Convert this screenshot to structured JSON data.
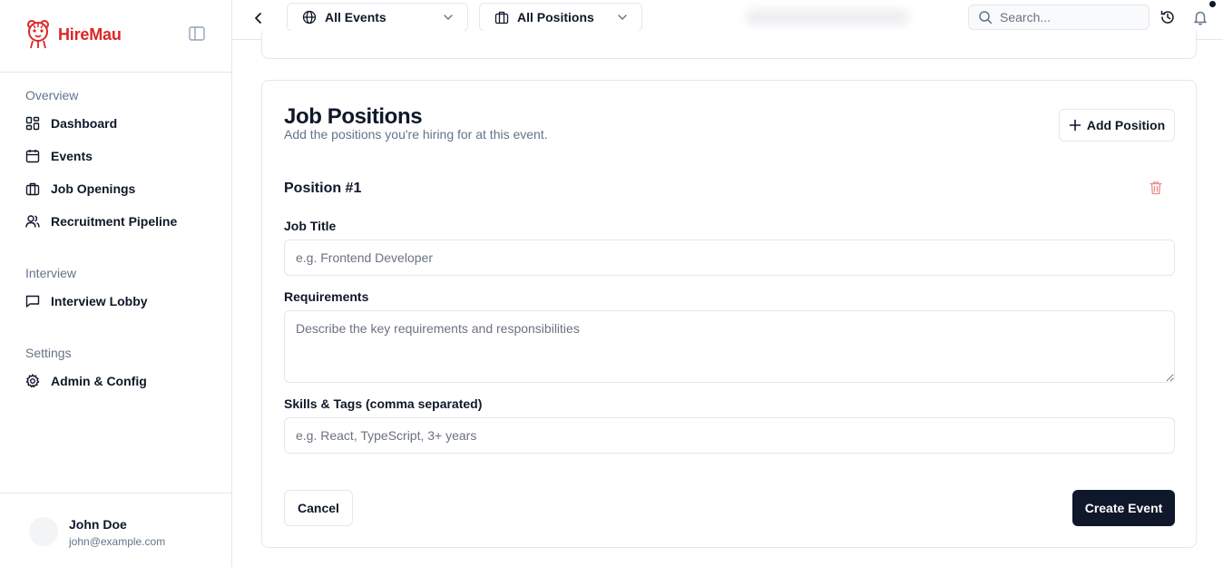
{
  "brand": {
    "name": "HireMau",
    "accent": "#dc2626"
  },
  "sidebar": {
    "groups": [
      {
        "label": "Overview",
        "items": [
          {
            "label": "Dashboard",
            "icon": "dashboard-icon"
          },
          {
            "label": "Events",
            "icon": "calendar-icon"
          },
          {
            "label": "Job Openings",
            "icon": "briefcase-icon"
          },
          {
            "label": "Recruitment Pipeline",
            "icon": "users-icon"
          }
        ]
      },
      {
        "label": "Interview",
        "items": [
          {
            "label": "Interview Lobby",
            "icon": "message-square-icon"
          }
        ]
      },
      {
        "label": "Settings",
        "items": [
          {
            "label": "Admin & Config",
            "icon": "gear-icon"
          }
        ]
      }
    ]
  },
  "user": {
    "name": "John Doe",
    "email": "john@example.com"
  },
  "topbar": {
    "events_filter": "All Events",
    "positions_filter": "All Positions",
    "search_placeholder": "Search..."
  },
  "card": {
    "title": "Job Positions",
    "description": "Add the positions you're hiring for at this event.",
    "add_button": "Add Position",
    "position_title": "Position #1",
    "job_title": {
      "label": "Job Title",
      "placeholder": "e.g. Frontend Developer"
    },
    "requirements": {
      "label": "Requirements",
      "placeholder": "Describe the key requirements and responsibilities"
    },
    "skills": {
      "label": "Skills & Tags (comma separated)",
      "placeholder": "e.g. React, TypeScript, 3+ years"
    },
    "cancel_button": "Cancel",
    "create_button": "Create Event"
  },
  "colors": {
    "primary": "#0f172a",
    "muted": "#64748b",
    "border": "#e5e7eb",
    "danger": "#ef4444"
  }
}
